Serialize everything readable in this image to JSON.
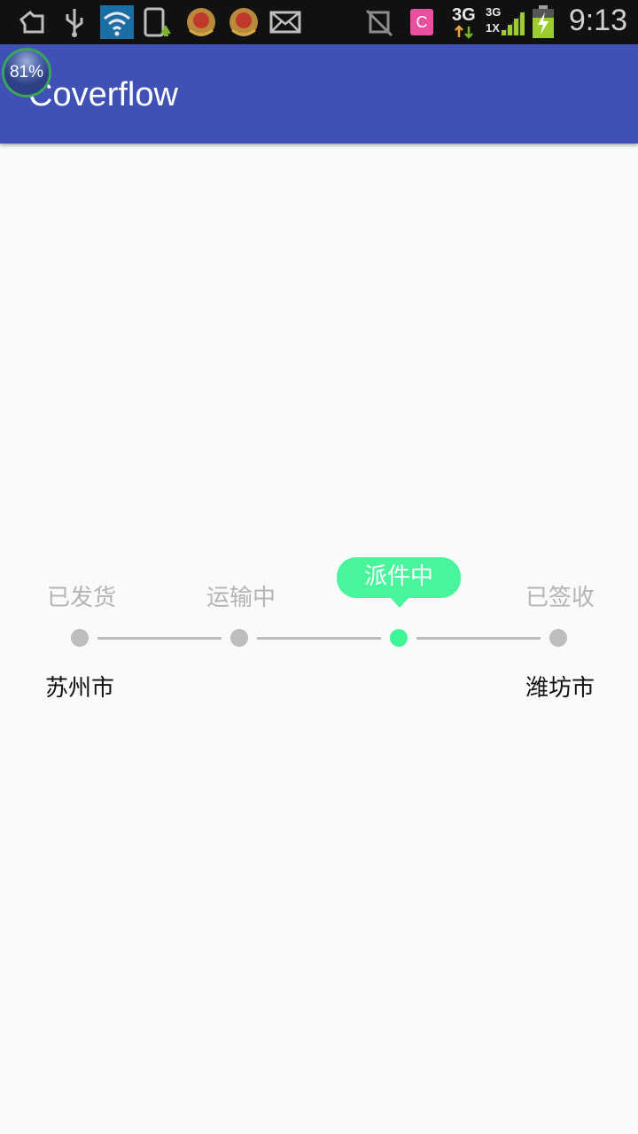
{
  "status_bar": {
    "time": "9:13",
    "network_1": "3G",
    "network_2_top": "3G",
    "network_2_bottom": "1X",
    "sim_label": "C",
    "icons": [
      "recycle-icon",
      "usb-icon",
      "wifi-icon",
      "phone-update-icon",
      "badge-icon",
      "badge-icon",
      "mail-icon",
      "mute-icon",
      "sim-icon",
      "signal-icon",
      "battery-charging-icon"
    ]
  },
  "app_bar": {
    "title": "Coverflow",
    "battery_percent": "81%"
  },
  "colors": {
    "app_bar": "#3f51b5",
    "active": "#48f59c",
    "inactive": "#bdbdbd",
    "background": "#fafafa"
  },
  "stepper": {
    "active_index": 2,
    "steps": [
      {
        "label": "已发货"
      },
      {
        "label": "运输中"
      },
      {
        "label": "派件中"
      },
      {
        "label": "已签收"
      }
    ],
    "origin_city": "苏州市",
    "destination_city": "潍坊市"
  }
}
